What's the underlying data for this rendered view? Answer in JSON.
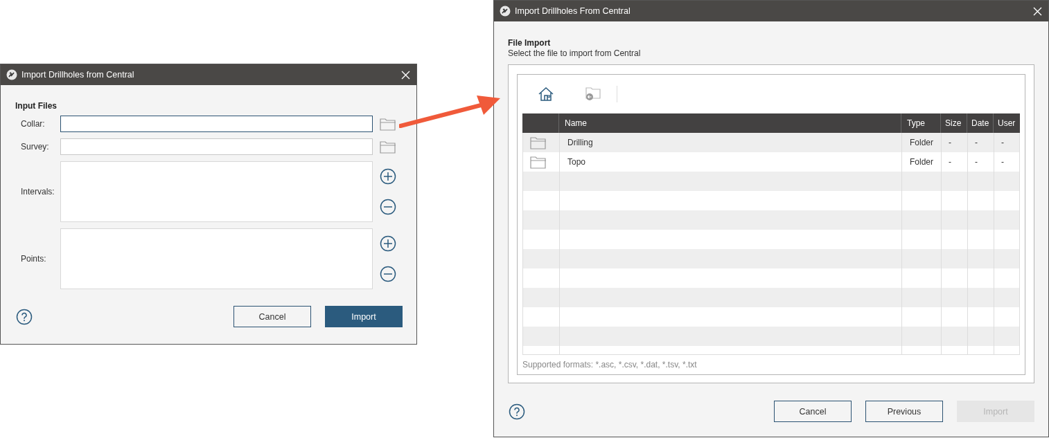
{
  "input_dialog": {
    "title": "Import Drillholes from Central",
    "section": "Input Files",
    "fields": [
      {
        "label": "Collar:",
        "kind": "file",
        "focused": true
      },
      {
        "label": "Survey:",
        "kind": "file",
        "focused": false
      },
      {
        "label": "Intervals:",
        "kind": "list"
      },
      {
        "label": "Points:",
        "kind": "list"
      }
    ],
    "buttons": [
      {
        "label": "Cancel",
        "primary": false,
        "disabled": false
      },
      {
        "label": "Import",
        "primary": true,
        "disabled": false
      }
    ]
  },
  "central_dialog": {
    "title": "Import Drillholes From Central",
    "heading": "File Import",
    "subtitle": "Select the file to import from Central",
    "table": {
      "columns": [
        "Name",
        "Type",
        "Size",
        "Date",
        "User"
      ],
      "rows": [
        {
          "name": "Drilling",
          "type": "Folder",
          "size": "-",
          "date": "-",
          "user": "-"
        },
        {
          "name": "Topo",
          "type": "Folder",
          "size": "-",
          "date": "-",
          "user": "-"
        }
      ]
    },
    "formats": "Supported formats: *.asc, *.csv, *.dat, *.tsv, *.txt",
    "buttons": [
      {
        "label": "Cancel",
        "primary": false,
        "disabled": false
      },
      {
        "label": "Previous",
        "primary": false,
        "disabled": false
      },
      {
        "label": "Import",
        "primary": false,
        "disabled": true
      }
    ]
  }
}
